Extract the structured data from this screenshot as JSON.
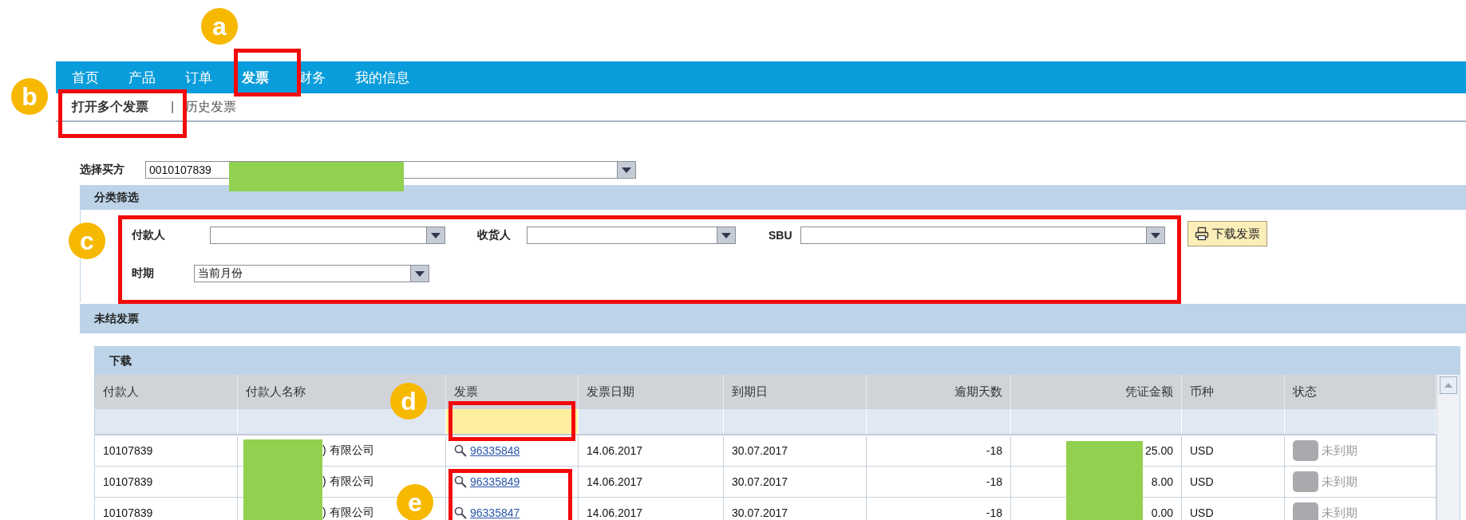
{
  "nav": [
    {
      "label": "首页",
      "selected": false
    },
    {
      "label": "产品",
      "selected": false
    },
    {
      "label": "订单",
      "selected": false
    },
    {
      "label": "发票",
      "selected": true
    },
    {
      "label": "财务",
      "selected": false
    },
    {
      "label": "我的信息",
      "selected": false
    }
  ],
  "subnav": {
    "tabs": [
      {
        "label": "打开多个发票",
        "selected": true
      },
      {
        "label": "历史发票",
        "selected": false
      }
    ],
    "separator": "|"
  },
  "buyer": {
    "label": "选择买方",
    "value": "0010107839"
  },
  "filter_section": {
    "title": "分类筛选",
    "payer_label": "付款人",
    "consignee_label": "收货人",
    "sbu_label": "SBU",
    "period_label": "时期",
    "period_value": "当前月份",
    "download_button": "下载发票"
  },
  "open_invoices": {
    "title": "未结发票",
    "panel_title": "下载",
    "columns": [
      {
        "label": "付款人",
        "numeric": false
      },
      {
        "label": "付款人名称",
        "numeric": false
      },
      {
        "label": "发票",
        "numeric": false
      },
      {
        "label": "发票日期",
        "numeric": false
      },
      {
        "label": "到期日",
        "numeric": false
      },
      {
        "label": "逾期天数",
        "numeric": true
      },
      {
        "label": "凭证金额",
        "numeric": true
      },
      {
        "label": "币种",
        "numeric": false
      },
      {
        "label": "状态",
        "numeric": false
      }
    ],
    "rows": [
      {
        "payer": "10107839",
        "payer_name": ") 有限公司",
        "invoice": "96335848",
        "invoice_date": "14.06.2017",
        "due_date": "30.07.2017",
        "days_overdue": "-18",
        "amount": "25.00",
        "currency": "USD",
        "status": "未到期"
      },
      {
        "payer": "10107839",
        "payer_name": ") 有限公司",
        "invoice": "96335849",
        "invoice_date": "14.06.2017",
        "due_date": "30.07.2017",
        "days_overdue": "-18",
        "amount": "8.00",
        "currency": "USD",
        "status": "未到期"
      },
      {
        "payer": "10107839",
        "payer_name": ") 有限公司",
        "invoice": "96335847",
        "invoice_date": "14.06.2017",
        "due_date": "30.07.2017",
        "days_overdue": "-18",
        "amount": "0.00",
        "currency": "USD",
        "status": "未到期"
      }
    ]
  },
  "callouts": [
    {
      "label": "a"
    },
    {
      "label": "b"
    },
    {
      "label": "c"
    },
    {
      "label": "d"
    },
    {
      "label": "e"
    }
  ]
}
